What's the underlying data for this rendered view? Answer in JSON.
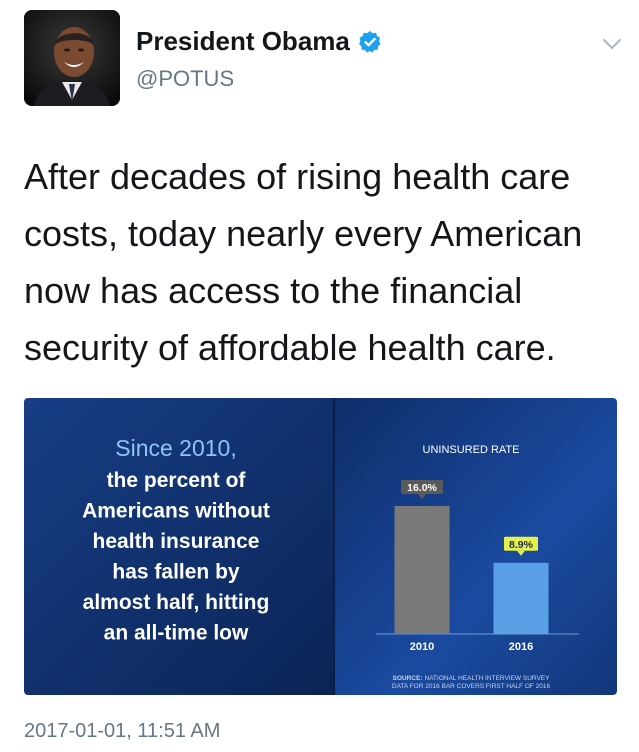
{
  "author": {
    "display_name": "President Obama",
    "handle": "@POTUS",
    "verified": true,
    "avatar_icon": "profile-photo"
  },
  "tweet": {
    "text": "After decades of rising health care costs, today nearly every American now has access to the financial security of affordable health care.",
    "timestamp": "2017-01-01, 11:51 AM"
  },
  "media": {
    "headline_line1": "Since 2010,",
    "headline_lines": [
      "the percent of",
      "Americans without",
      "health insurance",
      "has fallen by",
      "almost half, hitting",
      "an all-time low"
    ],
    "source_label": "SOURCE:",
    "source_text": "NATIONAL HEALTH INTERVIEW SURVEY",
    "source_note": "DATA FOR 2016 BAR COVERS FIRST HALF OF 2016"
  },
  "chart_data": {
    "type": "bar",
    "title": "UNINSURED RATE",
    "categories": [
      "2010",
      "2016"
    ],
    "values": [
      16.0,
      8.9
    ],
    "value_labels": [
      "16.0%",
      "8.9%"
    ],
    "bar_colors": [
      "#7a7a7a",
      "#5aa0e6"
    ],
    "label_colors": [
      "#5a5a5a",
      "#e6f04a"
    ],
    "ylim": [
      0,
      20
    ]
  },
  "colors": {
    "accent": "#1da1f2",
    "text": "#14171a",
    "muted": "#657786",
    "panel_dark": "#0f2a5e",
    "panel_mid": "#143a80"
  }
}
